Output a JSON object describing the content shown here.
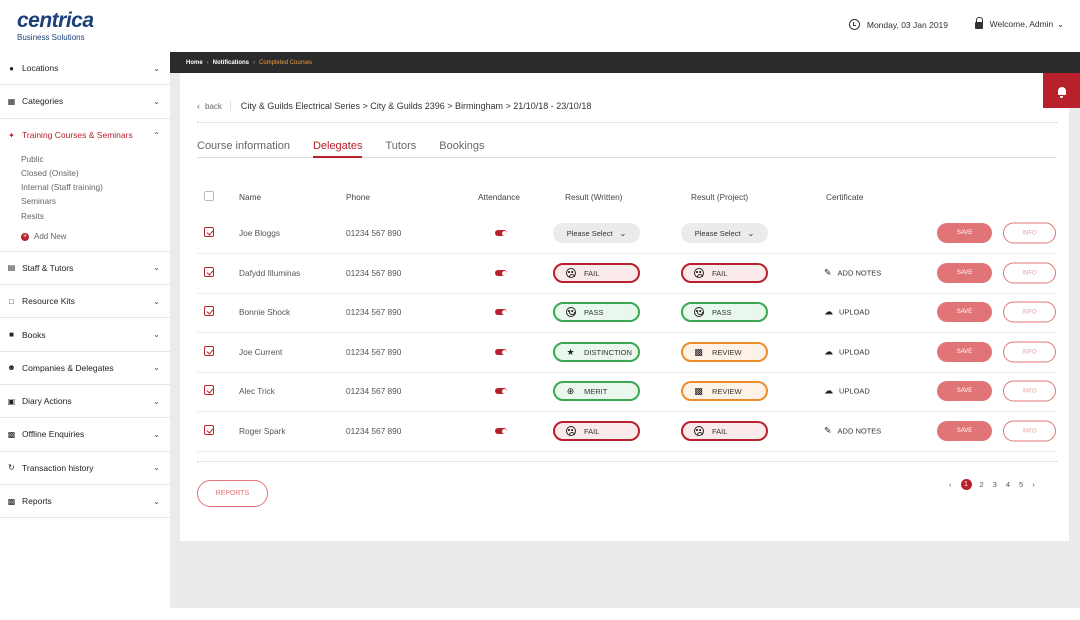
{
  "brand": {
    "name": "centrica",
    "sub": "Business Solutions"
  },
  "header": {
    "date": "Monday, 03 Jan 2019",
    "welcome": "Welcome, Admin"
  },
  "sidebar": {
    "items_top": [
      {
        "label": "Locations",
        "icon": "pin-icon"
      },
      {
        "label": "Categories",
        "icon": "grid-icon"
      }
    ],
    "active": {
      "label": "Training Courses & Seminars",
      "icon": "flash-icon"
    },
    "sub_items": [
      "Public",
      "Closed (Onsite)",
      "Internal (Staff training)",
      "Seminars",
      "Resits"
    ],
    "add_new": "Add New",
    "items_bottom": [
      {
        "label": "Staff & Tutors",
        "icon": "badge-icon"
      },
      {
        "label": "Resource Kits",
        "icon": "folder-icon"
      },
      {
        "label": "Books",
        "icon": "book-icon"
      },
      {
        "label": "Companies & Delegates",
        "icon": "people-icon"
      },
      {
        "label": "Diary Actions",
        "icon": "calendar-icon"
      },
      {
        "label": "Offline Enquiries",
        "icon": "chat-icon"
      },
      {
        "label": "Transaction history",
        "icon": "history-icon"
      },
      {
        "label": "Reports",
        "icon": "report-icon"
      }
    ]
  },
  "breadcrumb": {
    "home": "Home",
    "notifications": "Notifications",
    "current": "Completed Courses"
  },
  "course_path": {
    "back": "back",
    "path": "City & Guilds Electrical Series > City & Guilds 2396 > Birmingham > 21/10/18 - 23/10/18"
  },
  "tabs": [
    "Course information",
    "Delegates",
    "Tutors",
    "Bookings"
  ],
  "table": {
    "headers": [
      "Name",
      "Phone",
      "Attendance",
      "Result (Written)",
      "Result (Project)",
      "Certificate"
    ],
    "select_placeholder": "Please Select",
    "save_label": "SAVE",
    "info_label": "INFO",
    "rows": [
      {
        "name": "Joe Bloggs",
        "phone": "01234 567 890",
        "written": {
          "type": "select",
          "label": "Please Select"
        },
        "project": {
          "type": "select",
          "label": "Please Select"
        },
        "cert": {
          "label": "",
          "icon": ""
        }
      },
      {
        "name": "Dafydd Illuminas",
        "phone": "01234 567 890",
        "written": {
          "type": "fail",
          "label": "FAIL"
        },
        "project": {
          "type": "fail",
          "label": "FAIL"
        },
        "cert": {
          "label": "ADD NOTES",
          "icon": "pencil-icon"
        }
      },
      {
        "name": "Bonnie Shock",
        "phone": "01234 567 890",
        "written": {
          "type": "pass",
          "label": "PASS"
        },
        "project": {
          "type": "pass",
          "label": "PASS"
        },
        "cert": {
          "label": "UPLOAD",
          "icon": "upload-icon"
        }
      },
      {
        "name": "Joe Current",
        "phone": "01234 567 890",
        "written": {
          "type": "pass",
          "label": "DISTINCTION"
        },
        "project": {
          "type": "review",
          "label": "REVIEW"
        },
        "cert": {
          "label": "UPLOAD",
          "icon": "upload-icon"
        }
      },
      {
        "name": "Alec Trick",
        "phone": "01234 567 890",
        "written": {
          "type": "pass",
          "label": "MERIT"
        },
        "project": {
          "type": "review",
          "label": "REVIEW"
        },
        "cert": {
          "label": "UPLOAD",
          "icon": "upload-icon"
        }
      },
      {
        "name": "Roger Spark",
        "phone": "01234 567 890",
        "written": {
          "type": "fail",
          "label": "FAIL"
        },
        "project": {
          "type": "fail",
          "label": "FAIL"
        },
        "cert": {
          "label": "ADD NOTES",
          "icon": "pencil-icon"
        }
      }
    ]
  },
  "reports_label": "REPORTS",
  "pagination": {
    "pages": [
      "1",
      "2",
      "3",
      "4",
      "5"
    ],
    "current": "1"
  },
  "colors": {
    "accent": "#b8202c",
    "fail": "#b8202c",
    "pass": "#3aa852",
    "review": "#ee8b2c",
    "save": "#e07477"
  }
}
